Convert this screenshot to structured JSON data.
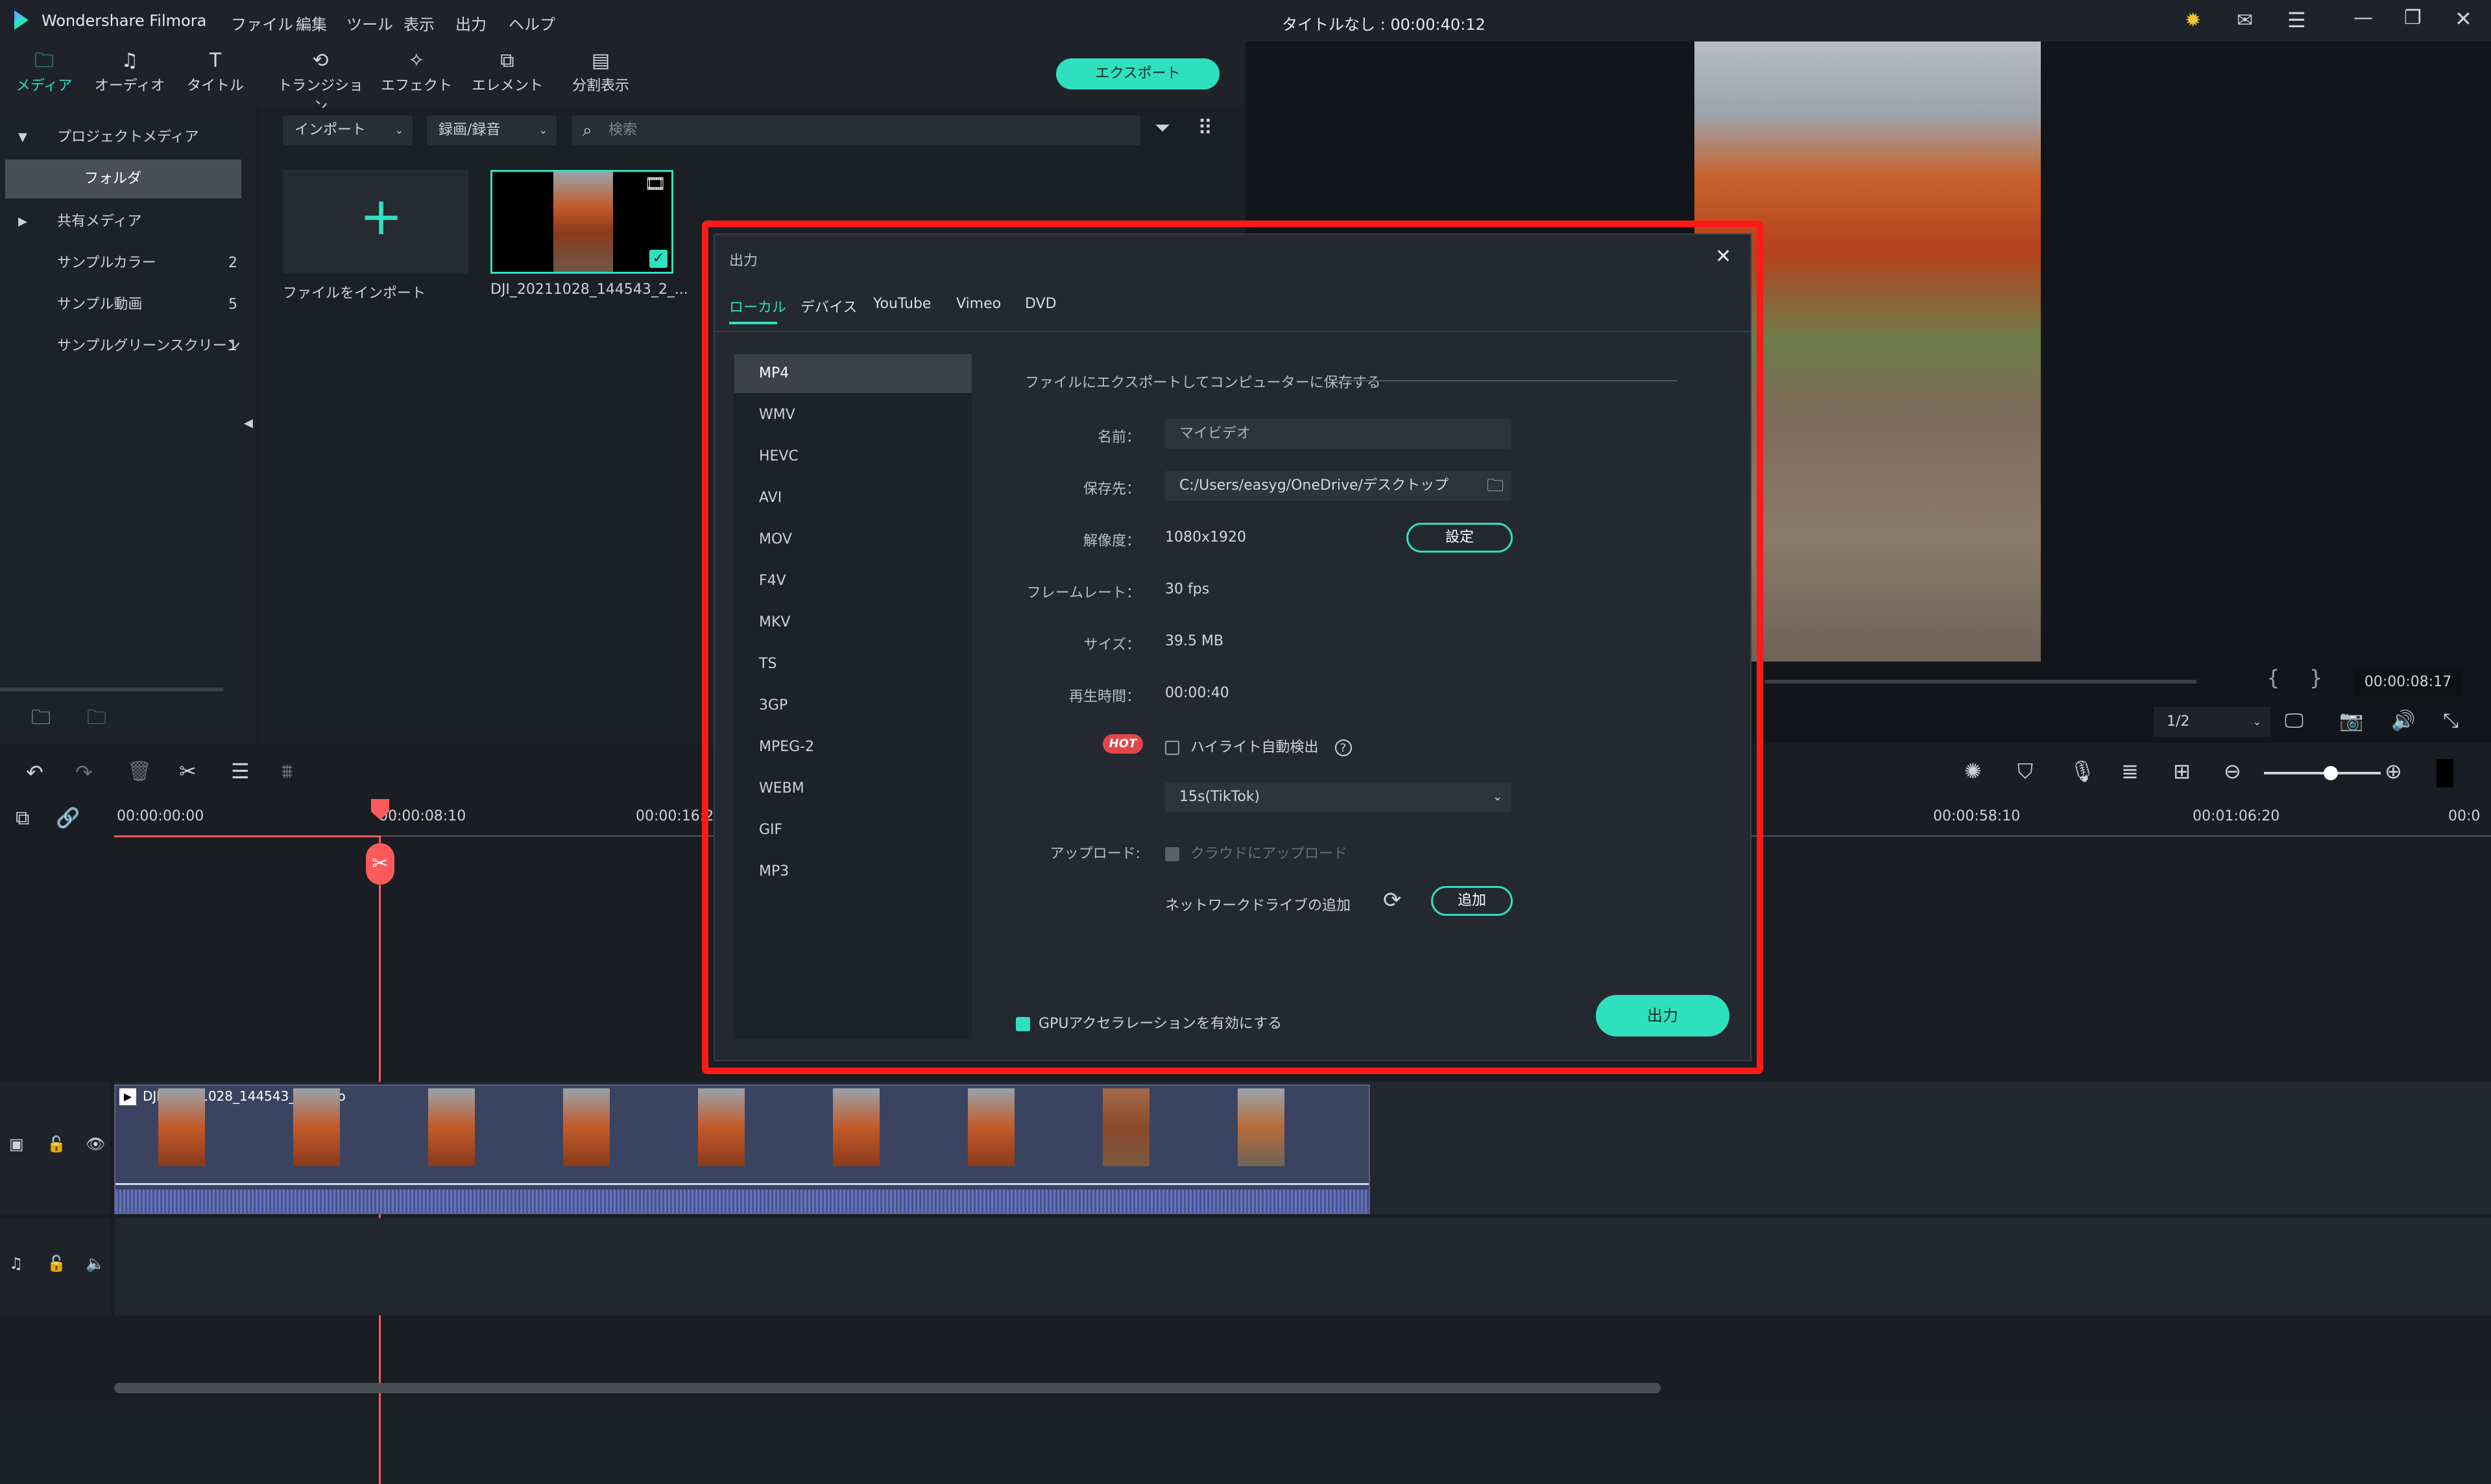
{
  "app": {
    "name": "Wondershare Filmora",
    "window_title": "タイトルなし : 00:00:40:12"
  },
  "menu": [
    "ファイル",
    "編集",
    "ツール",
    "表示",
    "出力",
    "ヘルプ"
  ],
  "toolbar": {
    "items": [
      {
        "label": "メディア",
        "icon": "folder-icon"
      },
      {
        "label": "オーディオ",
        "icon": "music-note-icon"
      },
      {
        "label": "タイトル",
        "icon": "text-t-icon"
      },
      {
        "label": "トランジション",
        "icon": "transition-icon"
      },
      {
        "label": "エフェクト",
        "icon": "effects-icon"
      },
      {
        "label": "エレメント",
        "icon": "elements-icon"
      },
      {
        "label": "分割表示",
        "icon": "split-screen-icon"
      }
    ],
    "export_label": "エクスポート"
  },
  "left_panel": {
    "project_media": "プロジェクトメディア",
    "folder": "フォルダ",
    "shared_media": "共有メディア",
    "items": [
      {
        "label": "サンプルカラー",
        "count": "2"
      },
      {
        "label": "サンプル動画",
        "count": "5"
      },
      {
        "label": "サンプルグリーンスクリーン",
        "count": "1"
      }
    ]
  },
  "media": {
    "import_combo": "インポート",
    "record_combo": "録画/録音",
    "search_placeholder": "検索",
    "import_tile_label": "ファイルをインポート",
    "clip_name": "DJI_20211028_144543_2_..."
  },
  "preview": {
    "bracket_left": "{",
    "bracket_right": "}",
    "timecode": "00:00:08:17",
    "zoom": "1/2"
  },
  "timeline": {
    "ticks": [
      "00:00:00:00",
      "00:00:08:10",
      "00:00:16:2",
      "00:00:58:10",
      "00:01:06:20",
      "00:0"
    ],
    "clip_label": "DJI_20211028_144543_2_video"
  },
  "dialog": {
    "title": "出力",
    "tabs": [
      "ローカル",
      "デバイス",
      "YouTube",
      "Vimeo",
      "DVD"
    ],
    "formats": [
      "MP4",
      "WMV",
      "HEVC",
      "AVI",
      "MOV",
      "F4V",
      "MKV",
      "TS",
      "3GP",
      "MPEG-2",
      "WEBM",
      "GIF",
      "MP3"
    ],
    "section_title": "ファイルにエクスポートしてコンピューターに保存する",
    "name_label": "名前：",
    "name_value": "マイビデオ",
    "dest_label": "保存先：",
    "dest_value": "C:/Users/easyg/OneDrive/デスクトップ",
    "resolution_label": "解像度：",
    "resolution_value": "1080x1920",
    "settings_label": "設定",
    "framerate_label": "フレームレート：",
    "framerate_value": "30 fps",
    "size_label": "サイズ：",
    "size_value": "39.5 MB",
    "duration_label": "再生時間：",
    "duration_value": "00:00:40",
    "hot_badge": "HOT",
    "highlight_label": "ハイライト自動検出",
    "highlight_select": "15s(TikTok)",
    "upload_label": "アップロード:",
    "cloud_label": "クラウドにアップロード",
    "network_label": "ネットワークドライブの追加",
    "add_label": "追加",
    "gpu_label": "GPUアクセラレーションを有効にする",
    "output_label": "出力"
  },
  "colors": {
    "accent": "#2fe0bf",
    "highlight_frame": "#ff1a1a",
    "playhead": "#ff5a5a",
    "hot": "#e2464a"
  }
}
